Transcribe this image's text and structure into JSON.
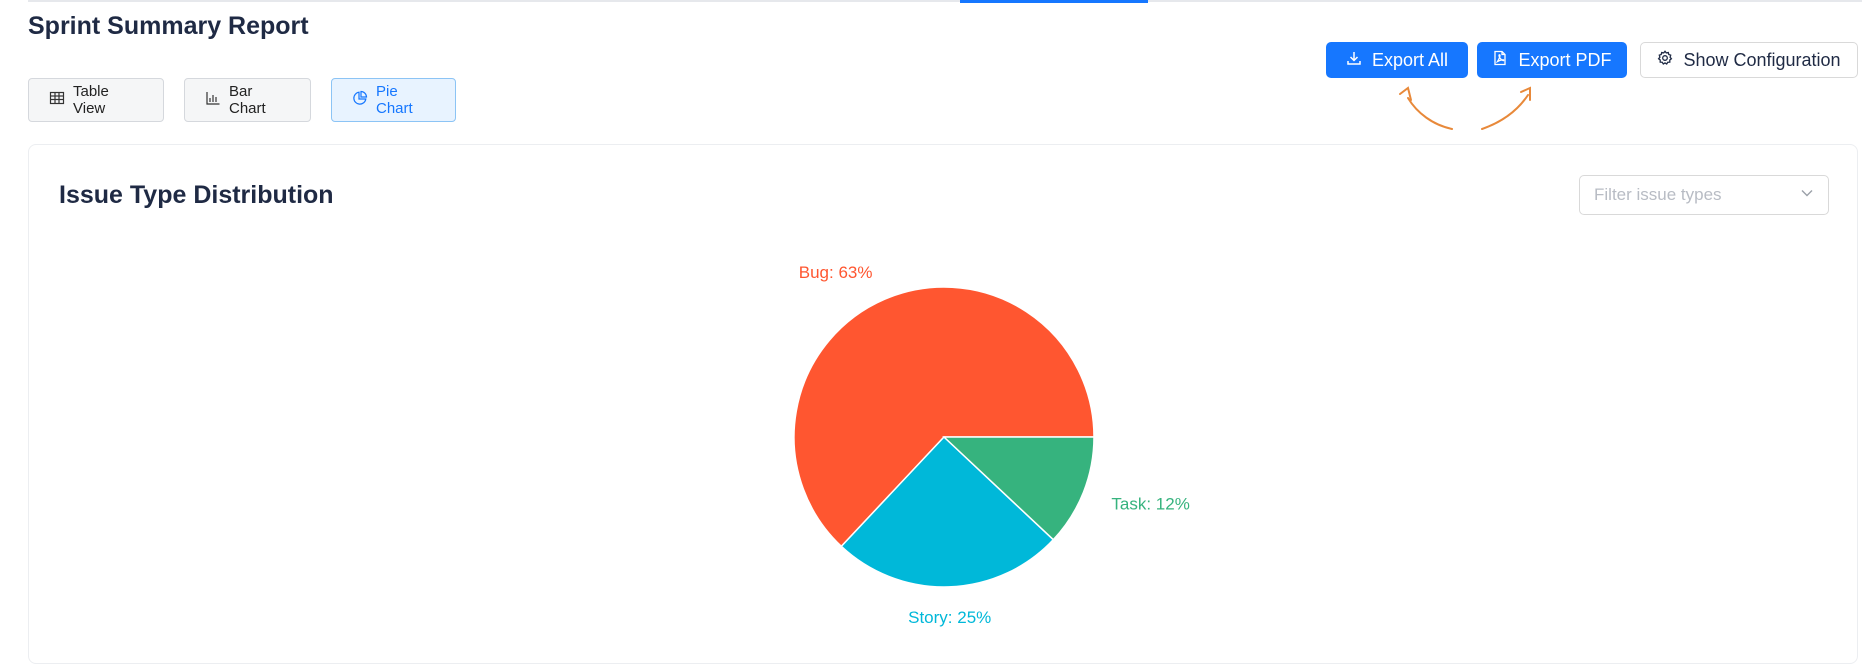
{
  "page": {
    "title": "Sprint Summary Report"
  },
  "view_switcher": {
    "items": [
      {
        "key": "table",
        "label": "Table View",
        "icon": "table-icon",
        "active": false
      },
      {
        "key": "bar",
        "label": "Bar Chart",
        "icon": "bar-chart-icon",
        "active": false
      },
      {
        "key": "pie",
        "label": "Pie Chart",
        "icon": "pie-chart-icon",
        "active": true
      }
    ]
  },
  "toolbar": {
    "export_all_label": "Export All",
    "export_pdf_label": "Export PDF",
    "show_config_label": "Show Configuration",
    "export_all_icon": "download-icon",
    "export_pdf_icon": "pdf-file-icon",
    "show_config_icon": "gear-icon"
  },
  "annotation": {
    "arrow_color": "#e8893a"
  },
  "card": {
    "title": "Issue Type Distribution",
    "filter": {
      "placeholder": "Filter issue types",
      "icon": "chevron-down-icon"
    }
  },
  "colors": {
    "primary": "#1677ff",
    "active_view_bg": "#e8f3ff"
  },
  "chart_data": {
    "type": "pie",
    "title": "Issue Type Distribution",
    "slices": [
      {
        "label": "Bug",
        "value": 63,
        "color": "#ff5630",
        "display": "Bug: 63%"
      },
      {
        "label": "Story",
        "value": 25,
        "color": "#00b8d9",
        "display": "Story: 25%"
      },
      {
        "label": "Task",
        "value": 12,
        "color": "#36b37e",
        "display": "Task: 12%"
      }
    ],
    "unit": "%",
    "legend": "none"
  }
}
